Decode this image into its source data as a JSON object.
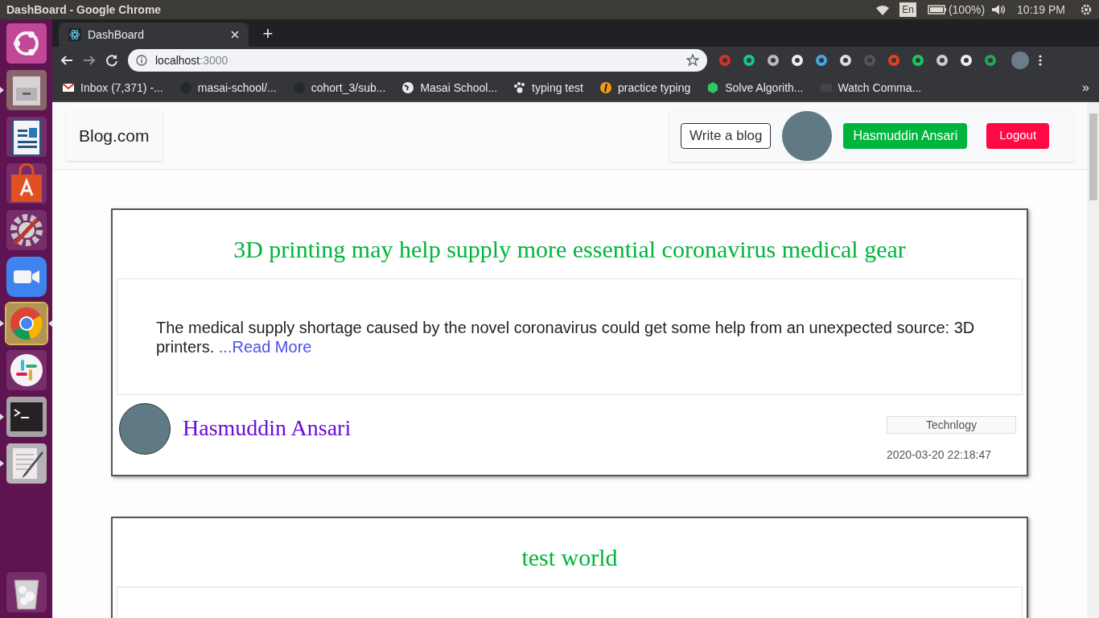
{
  "top_bar": {
    "title": "DashBoard - Google Chrome",
    "keyboard": "En",
    "battery": "(100%)",
    "time": "10:19 PM"
  },
  "launcher": [
    {
      "kind": "ubuntu",
      "running": false,
      "selected": false
    },
    {
      "kind": "files",
      "running": true,
      "selected": false
    },
    {
      "kind": "writer",
      "running": false,
      "selected": false
    },
    {
      "kind": "store",
      "running": false,
      "selected": false
    },
    {
      "kind": "settings",
      "running": false,
      "selected": false
    },
    {
      "kind": "zoom",
      "running": false,
      "selected": false
    },
    {
      "kind": "chrome",
      "running": true,
      "selected": true
    },
    {
      "kind": "slack",
      "running": false,
      "selected": false
    },
    {
      "kind": "terminal",
      "running": true,
      "selected": false
    },
    {
      "kind": "editor",
      "running": true,
      "selected": false
    },
    {
      "kind": "trash",
      "running": false,
      "selected": false
    }
  ],
  "browser": {
    "tab_title": "DashBoard",
    "new_tab": "+",
    "url_host": "localhost",
    "url_port": ":3000",
    "bookmarks": [
      "Inbox (7,371) -...",
      "masai-school/...",
      "cohort_3/sub...",
      "Masai School...",
      "typing test",
      "practice typing",
      "Solve Algorith...",
      "Watch Comma..."
    ],
    "bookmarks_overflow": "»"
  },
  "navbar": {
    "brand": "Blog.com",
    "write_button": "Write a blog",
    "user_button": "Hasmuddin Ansari",
    "logout_button": "Logout"
  },
  "posts": [
    {
      "title": "3D printing may help supply more essential coronavirus medical gear",
      "excerpt": "The medical supply shortage caused by the novel coronavirus could get some help from an unexpected source: 3D printers.",
      "read_more": "...Read More",
      "author": "Hasmuddin Ansari",
      "category": "Technlogy",
      "date": "2020-03-20 22:18:47"
    },
    {
      "title": "test world"
    }
  ]
}
